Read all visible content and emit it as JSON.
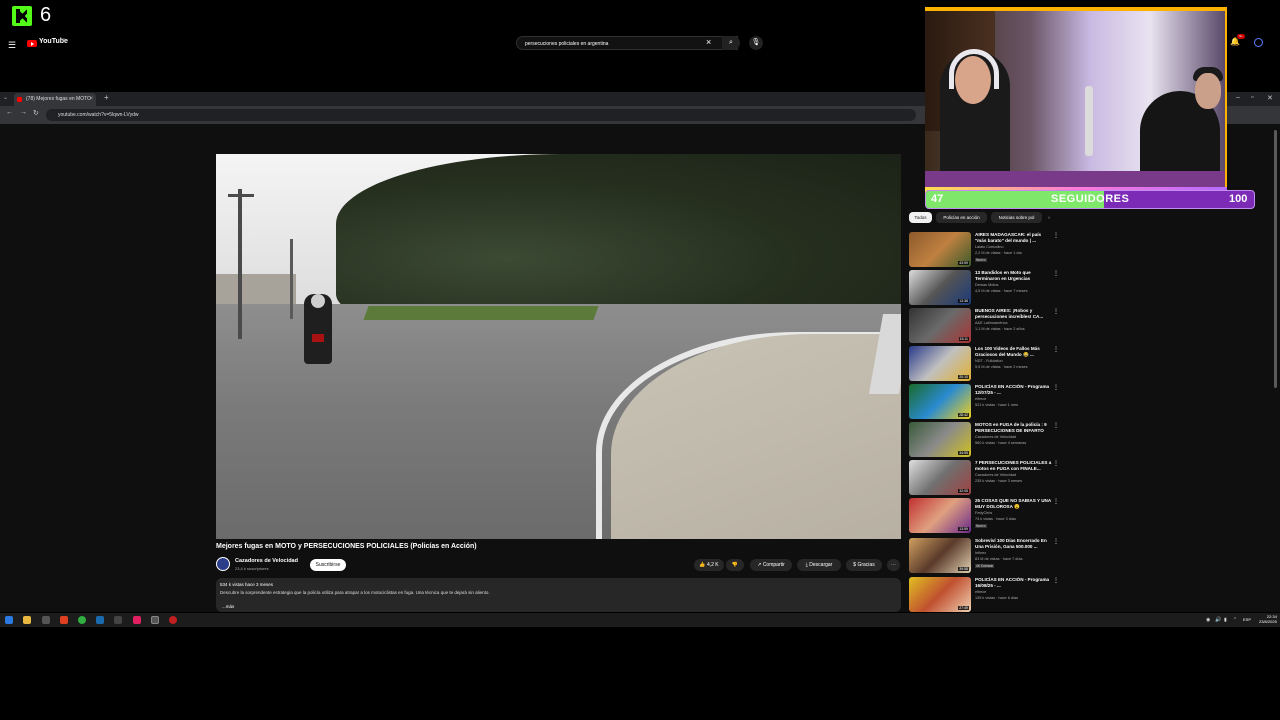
{
  "overlay": {
    "viewer_count": "6",
    "goal_current": "47",
    "goal_label": "SEGUIDORES",
    "goal_target": "100",
    "goal_progress": 0.47
  },
  "browser": {
    "tab_title": "(78) Mejores fugas en MOTO",
    "url": "youtube.com/watch?v=5lqwn-LVydw"
  },
  "youtube": {
    "logo_text": "YouTube",
    "region": "AR",
    "search_query": "persecuciones policiales en argentina",
    "notifications": "9+"
  },
  "video": {
    "title": "Mejores fugas en MOTO y PERSECUCIONES POLICIALES (Policías en Acción)",
    "channel": "Cazadores de Velocidad",
    "subscribers": "23,4 k suscriptores",
    "subscribe": "Suscribirse",
    "likes": "4,2 K",
    "share": "Compartir",
    "download": "Descargar",
    "thanks": "Gracias",
    "views_date": "534 k vistas  hace 3 meses",
    "description": "Descubre la sorprendente estrategia que la policía utiliza para atrapar a los motociclistas en fuga. Una técnica que te dejará sin aliento.",
    "more": "...más"
  },
  "chips": [
    "Todos",
    "Policías en acción",
    "Noticias sobre pol"
  ],
  "related": [
    {
      "title": "AIRES MADAGASCAR: el país \"más barato\" del mundo | ...",
      "channel": "Lalalo Comodino",
      "meta": "2,2 M de vistas · hace 1 día",
      "badge": "Nuevo",
      "duration": "43:59"
    },
    {
      "title": "13 Bandidos en Moto que Terminaron en Urgencias",
      "channel": "Demas Motos",
      "meta": "4,5 M de vistas · hace 7 meses",
      "badge": "",
      "duration": "13:38"
    },
    {
      "title": "BUENOS AIRES: ¡Robos y persecuciones increíbles! CA...",
      "channel": "A&E Latinoamérica",
      "meta": "1,1 M de vistas · hace 2 años",
      "badge": "",
      "duration": "15:11"
    },
    {
      "title": "Los 100 Videos de Fallos Más Graciosos del Mundo 😂 ...",
      "channel": "NDT - Fulldation",
      "meta": "5,5 M de vistas · hace 2 meses",
      "badge": "",
      "duration": "20:10"
    },
    {
      "title": "POLICÍAS EN ACCIÓN - Programa 12/07/25 - ...",
      "channel": "eltrece",
      "meta": "521 k vistas · hace 1 mes",
      "badge": "",
      "duration": "28:42"
    },
    {
      "title": "MOTOS en FUGA de la policía : 9 PERSECUCIONES DE INFARTO",
      "channel": "Cazadores de Velocidad",
      "meta": "560 k vistas · hace 4 semanas",
      "badge": "",
      "duration": "34:55"
    },
    {
      "title": "7 PERSECUCIONES POLICIALES a motos en FUGA con FINALE...",
      "channel": "Cazadores de Velocidad",
      "meta": "235 k vistas · hace 3 meses",
      "badge": "",
      "duration": "32:05"
    },
    {
      "title": "25 COSAS QUE NO SABIAS Y UNA MUY DOLOROSA 😮",
      "channel": "FedyChris",
      "meta": "74 k vistas · hace 3 días",
      "badge": "Nuevo",
      "duration": "13:59"
    },
    {
      "title": "Sobreviví 100 Días Encerrado En Una Prisión, Gana 500.000 ...",
      "channel": "Infinex",
      "meta": "83 M de vistas · hace 7 días",
      "badge": "4K Doblado",
      "duration": "39:58"
    },
    {
      "title": "POLICÍAS EN ACCIÓN - Programa 16/08/25 - ...",
      "channel": "eltrece",
      "meta": "139 k vistas · hace 6 días",
      "badge": "",
      "duration": "27:49"
    }
  ],
  "taskbar": {
    "lang": "ESP",
    "time": "22:34",
    "date": "23/8/2025"
  },
  "colors": {
    "youtube_red": "#ff0000",
    "kick_green": "#53fc18",
    "goal_purple": "#7b2bb5",
    "goal_green": "#7fe86a"
  }
}
